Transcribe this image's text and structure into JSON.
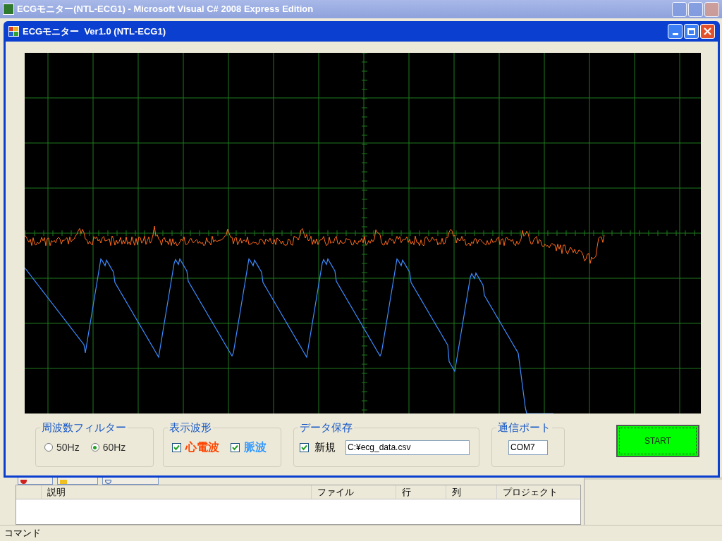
{
  "ide_window": {
    "title": "ECGモニター(NTL-ECG1) - Microsoft Visual C# 2008 Express Edition"
  },
  "app_window": {
    "title": "ECGモニター  Ver1.0 (NTL-ECG1)"
  },
  "traces": [
    {
      "kind": "ecg",
      "color": "#ff6a1a"
    },
    {
      "kind": "pulse",
      "color": "#3c8cff"
    }
  ],
  "filter": {
    "legend": "周波数フィルター",
    "options": [
      {
        "label": "50Hz",
        "selected": false
      },
      {
        "label": "60Hz",
        "selected": true
      }
    ]
  },
  "display": {
    "legend": "表示波形",
    "options": [
      {
        "label": "心電波",
        "checked": true,
        "color": "#ff4400"
      },
      {
        "label": "脈波",
        "checked": true,
        "color": "#3399ff"
      }
    ]
  },
  "save": {
    "legend": "データ保存",
    "new_file": {
      "label": "新規",
      "checked": true
    },
    "path": "C:¥ecg_data.csv"
  },
  "port": {
    "legend": "通信ポート",
    "value": "COM7"
  },
  "start_button": "START",
  "error_list": {
    "columns": [
      "説明",
      "ファイル",
      "行",
      "列",
      "プロジェクト"
    ]
  },
  "status_bar": "コマンド"
}
